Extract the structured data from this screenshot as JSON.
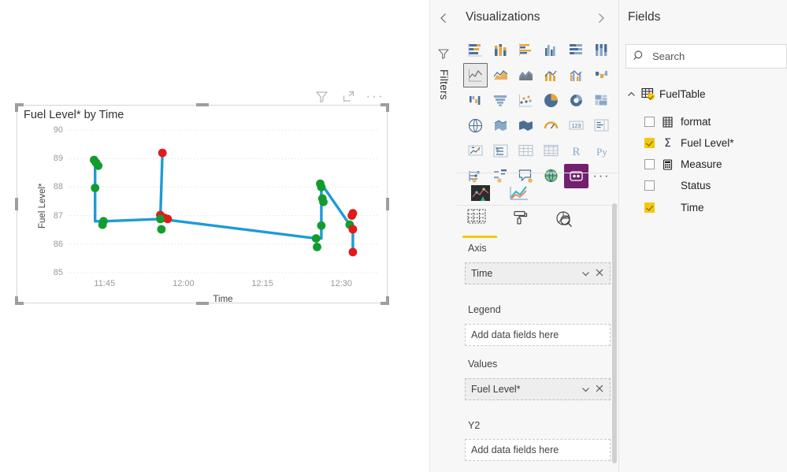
{
  "canvas": {
    "visual_header": {
      "filter_icon": "filter-funnel-icon",
      "focus_icon": "focus-mode-icon",
      "more_label": "···"
    },
    "visual": {
      "title": "Fuel Level* by Time"
    }
  },
  "chart_data": {
    "type": "line",
    "title": "Fuel Level* by Time",
    "xlabel": "Time",
    "ylabel": "Fuel Level*",
    "grid": true,
    "legend": "none",
    "ylim": [
      85,
      90
    ],
    "yticks": [
      "85",
      "86",
      "87",
      "88",
      "89",
      "90"
    ],
    "ytick_values": [
      85,
      86,
      87,
      88,
      89,
      90
    ],
    "xticks": [
      "11:45",
      "12:00",
      "12:15",
      "12:30"
    ],
    "xtick_minutes": [
      705,
      720,
      735,
      750
    ],
    "xlim_minutes": [
      698,
      757
    ],
    "line_color": "#1f9ad6",
    "marker_colors": {
      "ok": "#139c2e",
      "alert": "#e01b1b"
    },
    "series": [
      {
        "name": "Fuel Level*",
        "points": [
          {
            "x": "11:43",
            "x_min": 703.0,
            "y": 88.95,
            "status": "ok"
          },
          {
            "x": "11:43",
            "x_min": 703.4,
            "y": 88.85,
            "status": "ok"
          },
          {
            "x": "11:44",
            "x_min": 703.8,
            "y": 88.75,
            "status": "ok"
          },
          {
            "x": "11:44",
            "x_min": 703.2,
            "y": 87.97,
            "status": "ok"
          },
          {
            "x": "11:45",
            "x_min": 704.8,
            "y": 86.8,
            "status": "ok"
          },
          {
            "x": "11:45",
            "x_min": 704.6,
            "y": 86.68,
            "status": "ok"
          },
          {
            "x": "11:55",
            "x_min": 716.0,
            "y": 89.2,
            "status": "alert"
          },
          {
            "x": "11:55",
            "x_min": 715.6,
            "y": 87.02,
            "status": "alert"
          },
          {
            "x": "11:56",
            "x_min": 716.4,
            "y": 86.92,
            "status": "alert"
          },
          {
            "x": "11:56",
            "x_min": 717.0,
            "y": 86.88,
            "status": "alert"
          },
          {
            "x": "11:55",
            "x_min": 715.6,
            "y": 86.88,
            "status": "ok"
          },
          {
            "x": "11:56",
            "x_min": 715.8,
            "y": 86.52,
            "status": "ok"
          },
          {
            "x": "12:26",
            "x_min": 746.0,
            "y": 88.12,
            "status": "ok"
          },
          {
            "x": "12:26",
            "x_min": 746.2,
            "y": 88.0,
            "status": "ok"
          },
          {
            "x": "12:27",
            "x_min": 746.4,
            "y": 87.6,
            "status": "ok"
          },
          {
            "x": "12:27",
            "x_min": 746.6,
            "y": 87.48,
            "status": "ok"
          },
          {
            "x": "12:27",
            "x_min": 746.2,
            "y": 86.65,
            "status": "ok"
          },
          {
            "x": "12:25",
            "x_min": 745.2,
            "y": 86.2,
            "status": "ok"
          },
          {
            "x": "12:25",
            "x_min": 745.4,
            "y": 85.9,
            "status": "ok"
          },
          {
            "x": "12:32",
            "x_min": 752.2,
            "y": 87.08,
            "status": "alert"
          },
          {
            "x": "12:32",
            "x_min": 752.0,
            "y": 87.0,
            "status": "alert"
          },
          {
            "x": "12:32",
            "x_min": 751.6,
            "y": 86.68,
            "status": "ok"
          },
          {
            "x": "12:32",
            "x_min": 752.2,
            "y": 86.52,
            "status": "alert"
          },
          {
            "x": "12:33",
            "x_min": 752.2,
            "y": 85.72,
            "status": "alert"
          }
        ],
        "path_min": [
          703.2,
          703.2,
          704.8,
          715.6,
          716.0,
          715.6,
          745.2,
          746.2,
          746.2,
          751.6,
          752.2,
          752.2
        ],
        "path_val": [
          88.9,
          86.8,
          86.8,
          86.88,
          89.2,
          86.88,
          86.2,
          86.2,
          88.12,
          86.68,
          86.68,
          85.72
        ]
      }
    ]
  },
  "filters_rail": {
    "collapse_icon": "chevron-left-icon",
    "funnel_icon": "filter-funnel-icon",
    "label": "Filters"
  },
  "visualizations": {
    "title": "Visualizations",
    "expand_icon": "chevron-right-icon",
    "icons": [
      {
        "name": "stacked-bar-chart-icon",
        "selected": false
      },
      {
        "name": "stacked-column-chart-icon",
        "selected": false
      },
      {
        "name": "clustered-bar-chart-icon",
        "selected": false
      },
      {
        "name": "clustered-column-chart-icon",
        "selected": false
      },
      {
        "name": "100-stacked-bar-chart-icon",
        "selected": false
      },
      {
        "name": "100-stacked-column-chart-icon",
        "selected": false
      },
      {
        "name": "line-chart-icon",
        "selected": true
      },
      {
        "name": "area-chart-icon",
        "selected": false
      },
      {
        "name": "stacked-area-chart-icon",
        "selected": false
      },
      {
        "name": "line-stacked-column-chart-icon",
        "selected": false
      },
      {
        "name": "line-clustered-column-chart-icon",
        "selected": false
      },
      {
        "name": "ribbon-chart-icon",
        "selected": false
      },
      {
        "name": "waterfall-chart-icon",
        "selected": false
      },
      {
        "name": "funnel-chart-icon",
        "selected": false
      },
      {
        "name": "scatter-chart-icon",
        "selected": false
      },
      {
        "name": "pie-chart-icon",
        "selected": false
      },
      {
        "name": "donut-chart-icon",
        "selected": false
      },
      {
        "name": "treemap-icon",
        "selected": false
      },
      {
        "name": "map-icon",
        "selected": false
      },
      {
        "name": "filled-map-icon",
        "selected": false
      },
      {
        "name": "shape-map-icon",
        "selected": false
      },
      {
        "name": "gauge-icon",
        "selected": false
      },
      {
        "name": "card-icon",
        "selected": false
      },
      {
        "name": "multi-row-card-icon",
        "selected": false
      },
      {
        "name": "kpi-icon",
        "selected": false
      },
      {
        "name": "slicer-icon",
        "selected": false
      },
      {
        "name": "table-icon",
        "selected": false
      },
      {
        "name": "matrix-icon",
        "selected": false
      },
      {
        "name": "r-script-visual-icon",
        "selected": false
      },
      {
        "name": "python-visual-icon",
        "selected": false
      },
      {
        "name": "key-influencers-icon",
        "selected": false
      },
      {
        "name": "decomposition-tree-icon",
        "selected": false
      },
      {
        "name": "qna-visual-icon",
        "selected": false
      },
      {
        "name": "arcgis-maps-icon",
        "selected": false
      },
      {
        "name": "custom-visual-icon",
        "selected": false
      },
      {
        "name": "more-options-icon",
        "selected": false
      }
    ],
    "custom_icons": [
      {
        "name": "custom-visual-dark-icon"
      },
      {
        "name": "custom-line-chart-icon"
      }
    ],
    "prop_tabs": [
      {
        "name": "fields-tab",
        "icon": "fields-table-icon",
        "active": true
      },
      {
        "name": "format-tab",
        "icon": "paint-roller-icon",
        "active": false
      },
      {
        "name": "analytics-tab",
        "icon": "analytics-magnifier-icon",
        "active": false
      }
    ],
    "wells": [
      {
        "label": "Axis",
        "value": "Time",
        "placeholder": "",
        "filled": true
      },
      {
        "label": "Legend",
        "value": "",
        "placeholder": "Add data fields here",
        "filled": false
      },
      {
        "label": "Values",
        "value": "Fuel Level*",
        "placeholder": "",
        "filled": true
      },
      {
        "label": "Y2",
        "value": "",
        "placeholder": "Add data fields here",
        "filled": false
      }
    ]
  },
  "fields": {
    "title": "Fields",
    "search_placeholder": "Search",
    "search_value": "",
    "table": {
      "name": "FuelTable",
      "expanded": true,
      "checked": true
    },
    "items": [
      {
        "label": "format",
        "checked": false,
        "type_icon": "text-field-icon"
      },
      {
        "label": "Fuel Level*",
        "checked": true,
        "type_icon": "sigma-measure-icon"
      },
      {
        "label": "Measure",
        "checked": false,
        "type_icon": "calculator-measure-icon"
      },
      {
        "label": "Status",
        "checked": false,
        "type_icon": "none"
      },
      {
        "label": "Time",
        "checked": true,
        "type_icon": "none"
      }
    ]
  },
  "colors": {
    "accent": "#f2c811",
    "line": "#1f9ad6",
    "ok": "#139c2e",
    "alert": "#e01b1b",
    "panel_bg": "#f7f7f7"
  }
}
